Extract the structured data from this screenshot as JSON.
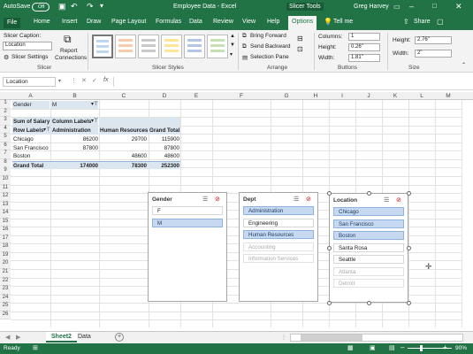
{
  "titlebar": {
    "autosave": "AutoSave",
    "autosave_state": "Off",
    "doc_title": "Employee Data - Excel",
    "context_tools": "Slicer Tools",
    "user": "Greg Harvey"
  },
  "tabs": [
    "File",
    "Home",
    "Insert",
    "Draw",
    "Page Layout",
    "Formulas",
    "Data",
    "Review",
    "View",
    "Help",
    "Options"
  ],
  "tell_me": "Tell me",
  "share": "Share",
  "ribbon": {
    "slicer_caption_label": "Slicer Caption:",
    "slicer_caption_value": "Location",
    "slicer_settings": "Slicer Settings",
    "report_connections_1": "Report",
    "report_connections_2": "Connections",
    "group_slicer": "Slicer",
    "group_styles": "Slicer Styles",
    "bring_forward": "Bring Forward",
    "send_backward": "Send Backward",
    "selection_pane": "Selection Pane",
    "group_arrange": "Arrange",
    "columns_label": "Columns:",
    "columns_value": "1",
    "btn_height_label": "Height:",
    "btn_height_value": "0.26\"",
    "btn_width_label": "Width:",
    "btn_width_value": "1.81\"",
    "group_buttons": "Buttons",
    "size_height_label": "Height:",
    "size_height_value": "2.76\"",
    "size_width_label": "Width:",
    "size_width_value": "2\"",
    "group_size": "Size"
  },
  "formula": {
    "namebox": "Location",
    "fx": "fx"
  },
  "columns": [
    "A",
    "B",
    "C",
    "D",
    "E",
    "F",
    "G",
    "H",
    "I",
    "J",
    "K",
    "L",
    "M"
  ],
  "rows": [
    "1",
    "2",
    "3",
    "4",
    "5",
    "6",
    "7",
    "8",
    "9",
    "10",
    "11",
    "12",
    "13",
    "14",
    "15",
    "16",
    "17",
    "18",
    "19",
    "20",
    "21",
    "22",
    "23",
    "24",
    "25",
    "26"
  ],
  "pivot": {
    "filter_label": "Gender",
    "filter_value": "M",
    "sum_label": "Sum of Salary",
    "col_labels": "Column Labels",
    "row_labels": "Row Labels",
    "headers": [
      "Administration",
      "Human Resources",
      "Grand Total"
    ],
    "data": [
      {
        "label": "Chicago",
        "admin": "86200",
        "hr": "29700",
        "total": "115900"
      },
      {
        "label": "San Francisco",
        "admin": "87800",
        "hr": "",
        "total": "87800"
      },
      {
        "label": "Boston",
        "admin": "",
        "hr": "48600",
        "total": "48600"
      }
    ],
    "grand": {
      "label": "Grand Total",
      "admin": "174000",
      "hr": "78300",
      "total": "252300"
    }
  },
  "slicers": {
    "gender": {
      "title": "Gender",
      "items": [
        {
          "label": "F",
          "state": "unsel"
        },
        {
          "label": "M",
          "state": "sel"
        }
      ]
    },
    "dept": {
      "title": "Dept",
      "items": [
        {
          "label": "Administration",
          "state": "sel"
        },
        {
          "label": "Engineering",
          "state": "unsel"
        },
        {
          "label": "Human Resources",
          "state": "sel"
        },
        {
          "label": "Accounting",
          "state": "nodata"
        },
        {
          "label": "Information Services",
          "state": "nodata"
        }
      ]
    },
    "location": {
      "title": "Location",
      "items": [
        {
          "label": "Chicago",
          "state": "sel"
        },
        {
          "label": "San Francisco",
          "state": "sel"
        },
        {
          "label": "Boston",
          "state": "sel"
        },
        {
          "label": "Santa Rosa",
          "state": "unsel"
        },
        {
          "label": "Seattle",
          "state": "unsel"
        },
        {
          "label": "Atlanta",
          "state": "nodata"
        },
        {
          "label": "Detroit",
          "state": "nodata"
        }
      ]
    }
  },
  "sheets": {
    "active": "Sheet2",
    "other": "Data",
    "add": "+"
  },
  "status": {
    "ready": "Ready",
    "zoom": "90%"
  },
  "colors": {
    "accent": "#217346",
    "slicer_selected": "#c6d9f0"
  }
}
